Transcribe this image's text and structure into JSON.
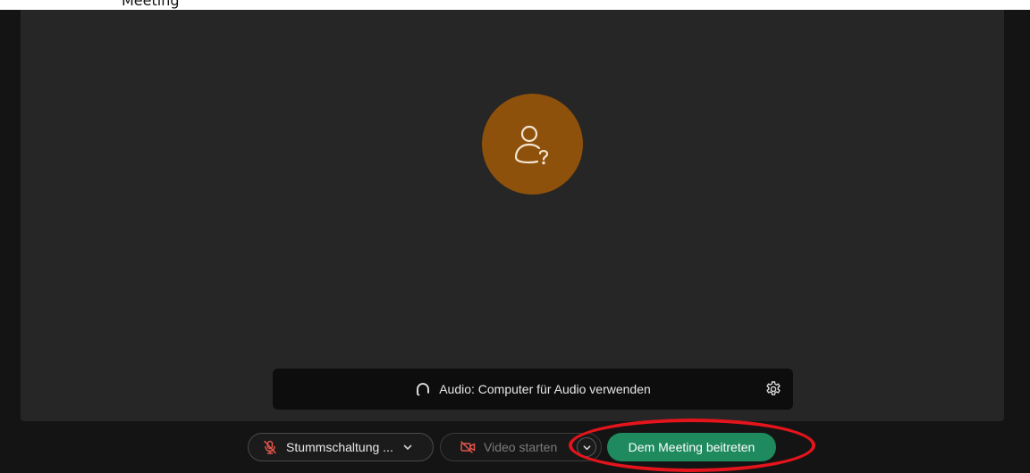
{
  "caption": {
    "text": "Meeting"
  },
  "avatar": {
    "icon": "unknown-user-icon",
    "color": "#8e510b"
  },
  "audio_bar": {
    "icon": "headphones-icon",
    "label": "Audio: Computer für Audio verwenden",
    "settings_icon": "gear-icon"
  },
  "controls": {
    "mute_label": "Stummschaltung ...",
    "mute_icon": "microphone-muted-icon",
    "mute_options_icon": "chevron-down-icon",
    "video_label": "Video starten",
    "video_icon": "video-off-icon",
    "video_options_icon": "chevron-down-icon",
    "join_label": "Dem Meeting beitreten",
    "join_color": "#1e8a5e"
  },
  "annotation": {
    "color": "#e3141b"
  }
}
